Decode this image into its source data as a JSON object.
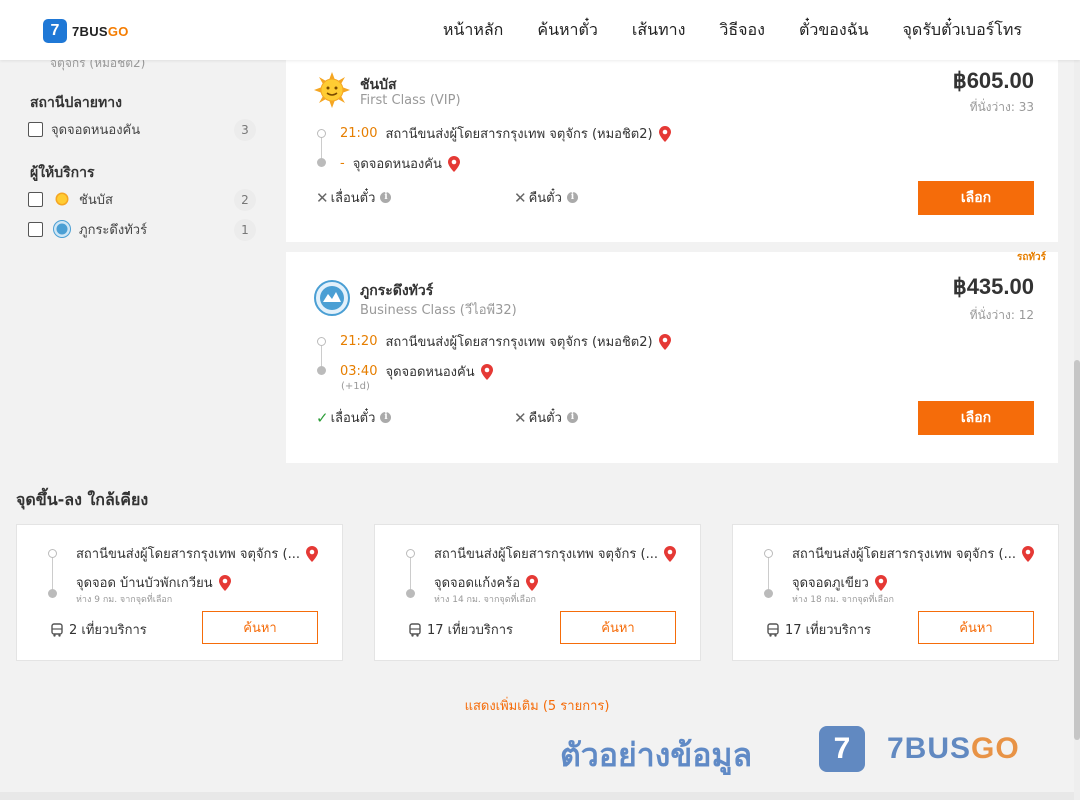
{
  "header": {
    "logo_number": "7",
    "logo_text_a": "7BUS",
    "logo_text_b": "GO",
    "nav": [
      "หน้าหลัก",
      "ค้นหาตั๋ว",
      "เส้นทาง",
      "วิธีจอง",
      "ตั๋วของฉัน",
      "จุดรับตั๋วเบอร์โทร"
    ]
  },
  "sidebar": {
    "cut_text": "จตุจักร (หมอชิต2)",
    "destination_title": "สถานีปลายทาง",
    "destination_items": [
      {
        "label": "จุดจอดหนองคัน",
        "count": "3"
      }
    ],
    "operator_title": "ผู้ให้บริการ",
    "operator_items": [
      {
        "label": "ชันบัส",
        "count": "2"
      },
      {
        "label": "ภูกระดึงทัวร์",
        "count": "1"
      }
    ]
  },
  "buses": [
    {
      "operator": "ชันบัส",
      "bus_class": "First Class (VIP)",
      "price": "฿605.00",
      "seats": "ที่นั่งว่าง: 33",
      "depart_time": "21:00",
      "depart_station": "สถานีขนส่งผู้โดยสารกรุงเทพ จตุจักร (หมอชิต2)",
      "arrive_time": "-",
      "arrive_station": "จุดจอดหนองคัน",
      "reschedule": "เลื่อนตั๋ว",
      "refund": "คืนตั๋ว",
      "select": "เลือก"
    },
    {
      "operator": "ภูกระดึงทัวร์",
      "bus_class": "Business Class (วีไอพี32)",
      "price": "฿435.00",
      "seats": "ที่นั่งว่าง: 12",
      "promo": "รถทัวร์",
      "depart_time": "21:20",
      "depart_station": "สถานีขนส่งผู้โดยสารกรุงเทพ จตุจักร (หมอชิต2)",
      "arrive_time": "03:40",
      "arrive_station": "จุดจอดหนองคัน",
      "next_day": "(+1d)",
      "reschedule": "เลื่อนตั๋ว",
      "refund": "คืนตั๋ว",
      "select": "เลือก"
    }
  ],
  "nearby": {
    "title": "จุดขึ้น-ลง ใกล้เคียง",
    "items": [
      {
        "from": "สถานีขนส่งผู้โดยสารกรุงเทพ จตุจักร (...",
        "to": "จุดจอด บ้านบัวพักเกวียน",
        "distance": "ห่าง 9 กม. จากจุดที่เลือก",
        "trips": "2 เที่ยวบริการ",
        "button": "ค้นหา"
      },
      {
        "from": "สถานีขนส่งผู้โดยสารกรุงเทพ จตุจักร (...",
        "to": "จุดจอดแก้งคร้อ",
        "distance": "ห่าง 14 กม. จากจุดที่เลือก",
        "trips": "17 เที่ยวบริการ",
        "button": "ค้นหา"
      },
      {
        "from": "สถานีขนส่งผู้โดยสารกรุงเทพ จตุจักร (...",
        "to": "จุดจอดภูเขียว",
        "distance": "ห่าง 18 กม. จากจุดที่เลือก",
        "trips": "17 เที่ยวบริการ",
        "button": "ค้นหา"
      }
    ],
    "show_more": "แสดงเพิ่มเติม (5 รายการ)"
  },
  "watermark": {
    "text": "ตัวอย่างข้อมูล",
    "badge": "7",
    "brand_a": "7BUS",
    "brand_b": "GO"
  },
  "colors": {
    "accent": "#f56c0a",
    "brand_blue": "#1f78d6",
    "pin_red": "#e53935",
    "check_green": "#2e9e3a"
  }
}
